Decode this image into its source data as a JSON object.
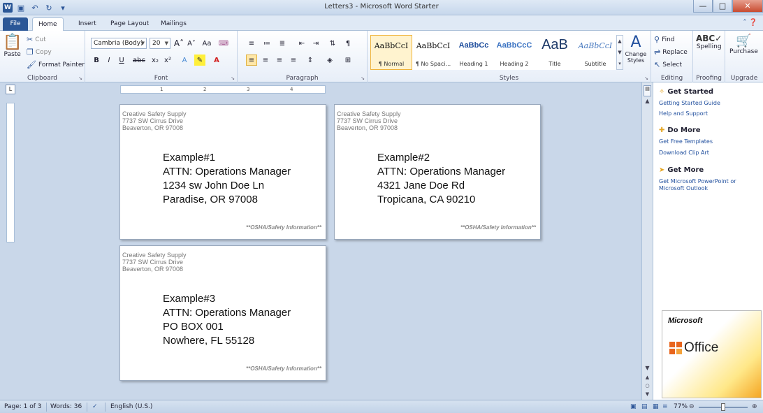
{
  "window": {
    "title": "Letters3 - Microsoft Word Starter"
  },
  "tabs": [
    "File",
    "Home",
    "Insert",
    "Page Layout",
    "Mailings"
  ],
  "ribbon": {
    "clipboard": {
      "label": "Clipboard",
      "paste": "Paste",
      "cut": "Cut",
      "copy": "Copy",
      "format_painter": "Format Painter"
    },
    "font": {
      "label": "Font",
      "font_name": "Cambria (Body)",
      "font_size": "20"
    },
    "paragraph": {
      "label": "Paragraph"
    },
    "styles": {
      "label": "Styles",
      "items": [
        {
          "sample": "AaBbCcI",
          "name": "¶ Normal"
        },
        {
          "sample": "AaBbCcI",
          "name": "¶ No Spaci..."
        },
        {
          "sample": "AaBbCc",
          "name": "Heading 1"
        },
        {
          "sample": "AaBbCcC",
          "name": "Heading 2"
        },
        {
          "sample": "AaB",
          "name": "Title"
        },
        {
          "sample": "AaBbCcI",
          "name": "Subtitle"
        }
      ],
      "change_styles": "Change Styles"
    },
    "editing": {
      "label": "Editing",
      "find": "Find",
      "replace": "Replace",
      "select": "Select"
    },
    "proofing": {
      "label": "Proofing",
      "spelling": "Spelling"
    },
    "upgrade": {
      "label": "Upgrade",
      "purchase": "Purchase"
    }
  },
  "ruler": {
    "ticks": [
      "1",
      "2",
      "3",
      "4"
    ]
  },
  "document": {
    "return_address": {
      "line1": "Creative Safety Supply",
      "line2": "7737 SW Cirrus Drive",
      "line3": "Beaverton, OR 97008"
    },
    "footer_text": "**OSHA/Safety Information**",
    "letters": [
      {
        "line1": "Example#1",
        "line2": "ATTN: Operations Manager",
        "line3": "1234 sw John Doe Ln",
        "line4": "Paradise, OR 97008"
      },
      {
        "line1": "Example#2",
        "line2": "ATTN: Operations Manager",
        "line3": "4321 Jane Doe Rd",
        "line4": "Tropicana, CA 90210"
      },
      {
        "line1": "Example#3",
        "line2": "ATTN: Operations Manager",
        "line3": "PO BOX 001",
        "line4": "Nowhere, FL 55128"
      }
    ]
  },
  "sidepane": {
    "get_started": {
      "heading": "Get Started",
      "links": [
        "Getting Started Guide",
        "Help and Support"
      ]
    },
    "do_more": {
      "heading": "Do More",
      "links": [
        "Get Free Templates",
        "Download Clip Art"
      ]
    },
    "get_more": {
      "heading": "Get More",
      "links": [
        "Get Microsoft PowerPoint or Microsoft Outlook"
      ]
    },
    "ad": {
      "brand": "Microsoft",
      "product": "Office"
    }
  },
  "statusbar": {
    "page": "Page: 1 of 3",
    "words": "Words: 36",
    "language": "English (U.S.)",
    "zoom": "77%"
  },
  "colors": {
    "accent": "#2b5797",
    "link": "#1f4e9d",
    "background": "#c9d7e9"
  }
}
